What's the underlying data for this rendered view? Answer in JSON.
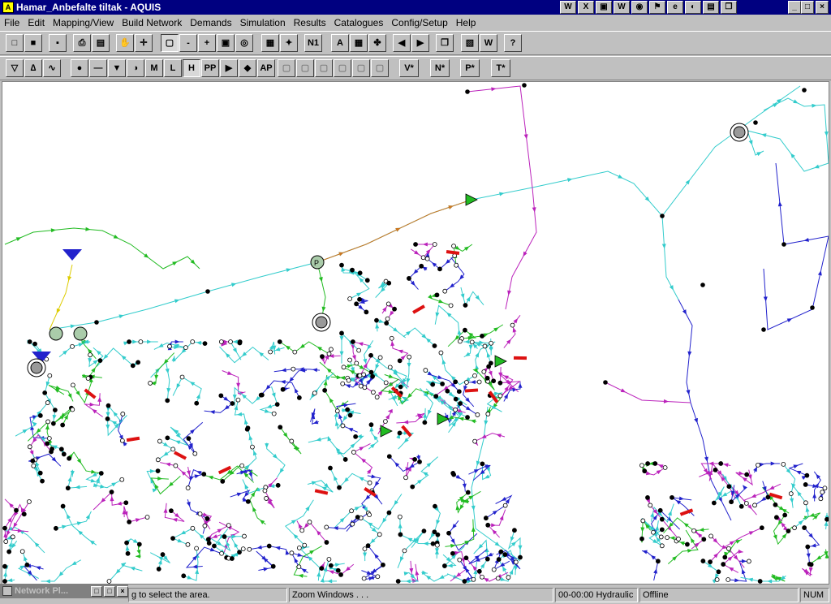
{
  "window": {
    "title": "Hamar_Anbefalte tiltak - AQUIS",
    "minimize": "_",
    "maximize": "□",
    "close": "×"
  },
  "menu": [
    "File",
    "Edit",
    "Mapping/View",
    "Build Network",
    "Demands",
    "Simulation",
    "Results",
    "Catalogues",
    "Config/Setup",
    "Help"
  ],
  "quicklaunch": [
    "W",
    "X",
    "▣",
    "W",
    "◉",
    "⚑",
    "e",
    "◐",
    "▤",
    "❐"
  ],
  "toolbar1": [
    {
      "name": "new-button",
      "label": "□"
    },
    {
      "name": "open-button",
      "label": "■"
    },
    {
      "name": "save-button",
      "label": "▪"
    },
    {
      "name": "print-button",
      "label": "⎙"
    },
    {
      "name": "print-preview-button",
      "label": "▤"
    },
    {
      "name": "pan-hand-button",
      "label": "✋"
    },
    {
      "name": "move-button",
      "label": "✛"
    },
    {
      "name": "zoom-window-button",
      "label": "▢"
    },
    {
      "name": "zoom-out-button",
      "label": "-"
    },
    {
      "name": "zoom-in-button",
      "label": "+"
    },
    {
      "name": "zoom-extents-button",
      "label": "▣"
    },
    {
      "name": "zoom-previous-button",
      "label": "◎"
    },
    {
      "name": "select-area-button",
      "label": "▦"
    },
    {
      "name": "select-tool-button",
      "label": "✦"
    },
    {
      "name": "node-id-button",
      "label": "N1"
    },
    {
      "name": "label-button",
      "label": "A"
    },
    {
      "name": "table-button",
      "label": "▦"
    },
    {
      "name": "help-lifebuoy-button",
      "label": "✤"
    },
    {
      "name": "back-button",
      "label": "◀"
    },
    {
      "name": "forward-button",
      "label": "▶"
    },
    {
      "name": "export-button",
      "label": "❐"
    },
    {
      "name": "map-layer-button",
      "label": "▧"
    },
    {
      "name": "word-export-button",
      "label": "W"
    },
    {
      "name": "help-question-button",
      "label": "?"
    }
  ],
  "toolbar2": [
    {
      "name": "filter-button",
      "label": "▽"
    },
    {
      "name": "pump-tool-button",
      "label": "∆"
    },
    {
      "name": "curve-tool-button",
      "label": "∿"
    },
    {
      "name": "node-tool-button",
      "label": "●"
    },
    {
      "name": "pipe-tool-button",
      "label": "—"
    },
    {
      "name": "reservoir-tool-button",
      "label": "▼"
    },
    {
      "name": "valve-tool-button",
      "label": "◑"
    },
    {
      "name": "meter-tool-button",
      "label": "M"
    },
    {
      "name": "level-tool-button",
      "label": "L"
    },
    {
      "name": "hydrant-tool-button",
      "label": "H"
    },
    {
      "name": "pp-tool-button",
      "label": "PP"
    },
    {
      "name": "play-tool-button",
      "label": "▶"
    },
    {
      "name": "stop-tool-button",
      "label": "◆"
    },
    {
      "name": "ap-tool-button",
      "label": "AP"
    },
    {
      "name": "disabled-tool-1",
      "label": "▢"
    },
    {
      "name": "disabled-tool-2",
      "label": "▢"
    },
    {
      "name": "disabled-tool-3",
      "label": "▢"
    },
    {
      "name": "disabled-tool-4",
      "label": "▢"
    },
    {
      "name": "disabled-tool-5",
      "label": "▢"
    },
    {
      "name": "disabled-tool-6",
      "label": "▢"
    },
    {
      "name": "v-star-button",
      "label": "V*"
    },
    {
      "name": "n-star-button",
      "label": "N*"
    },
    {
      "name": "p-star-button",
      "label": "P*"
    },
    {
      "name": "t-star-button",
      "label": "T*"
    }
  ],
  "map": {
    "label_p": "P"
  },
  "minimized_window": {
    "title": "Network Pl...",
    "restore": "□",
    "maximize": "□",
    "close": "×"
  },
  "status": {
    "hint": "g to select the area.",
    "zoom": "Zoom Windows . . .",
    "time": "00-00:00 Hydraulic",
    "mode": "Offline",
    "num": "NUM"
  },
  "colors": {
    "pipe_cyan": "#33cccc",
    "pipe_green": "#22bb22",
    "pipe_blue": "#2222cc",
    "pipe_magenta": "#bb22bb",
    "pipe_orange": "#cc7722",
    "valve_red": "#dd1111"
  }
}
